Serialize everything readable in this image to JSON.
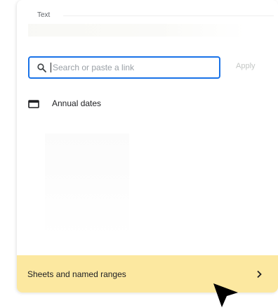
{
  "header": {
    "text_label": "Text"
  },
  "search": {
    "placeholder": "Search or paste a link",
    "value": ""
  },
  "apply_button": {
    "label": "Apply"
  },
  "results": [
    {
      "label": "Annual dates",
      "icon": "folder-icon"
    }
  ],
  "footer": {
    "sheets_label": "Sheets and named ranges",
    "icon": "chevron-right-icon"
  },
  "colors": {
    "accent": "#1a73e8",
    "highlight": "#fce8a0",
    "text": "#202124",
    "muted": "#9aa0a6"
  }
}
